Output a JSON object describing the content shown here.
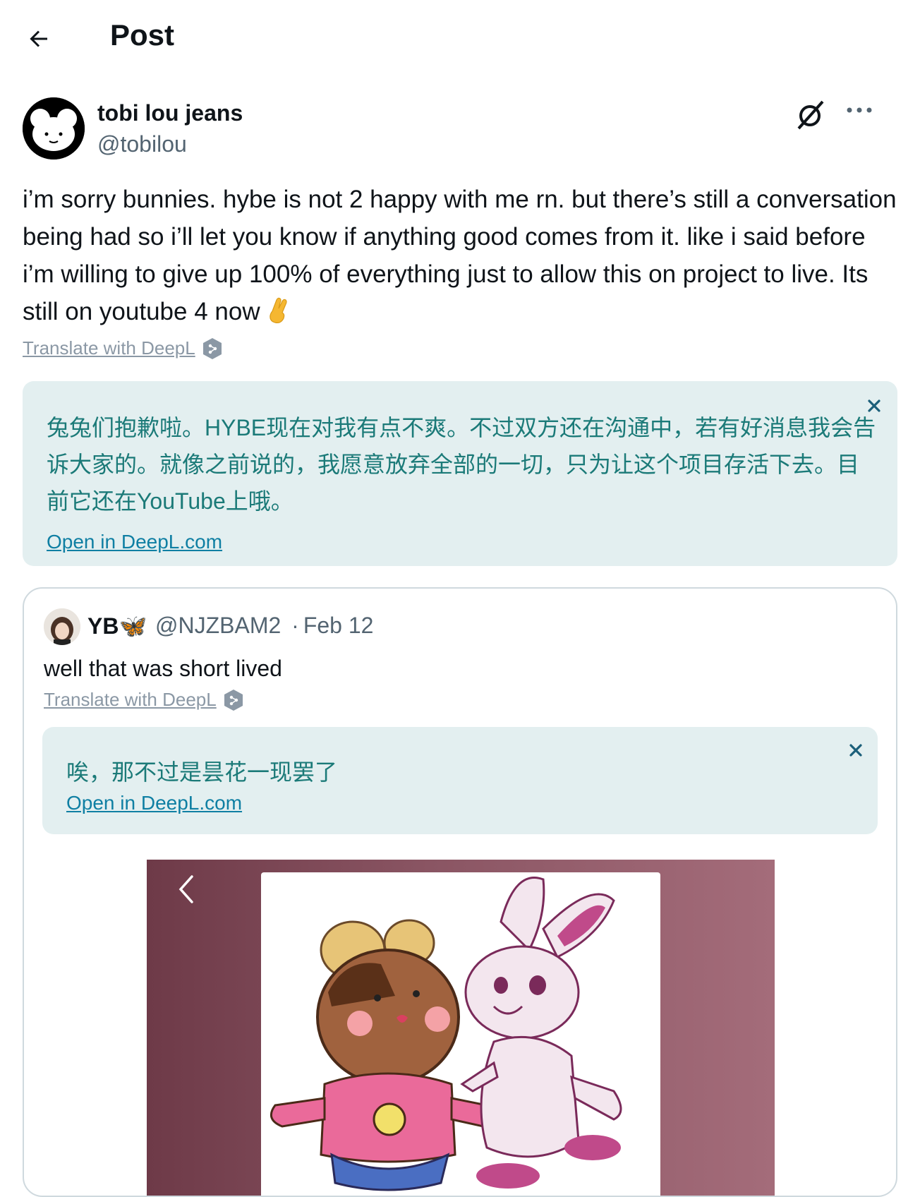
{
  "header": {
    "title": "Post"
  },
  "author": {
    "display_name": "tobi lou jeans",
    "handle": "@tobilou"
  },
  "post": {
    "text": "i’m sorry bunnies.  hybe is not 2 happy with me rn.  but there’s still a conversation being had so i’ll let you know if anything good comes from it.  like i said before i’m willing to give up 100% of everything just to allow this on project to live.   Its still on youtube 4 now",
    "emoji": "crossed-fingers-emoji",
    "translate_label": "Translate with DeepL"
  },
  "translation": {
    "text": "兔兔们抱歉啦。HYBE现在对我有点不爽。不过双方还在沟通中，若有好消息我会告诉大家的。就像之前说的，我愿意放弃全部的一切，只为让这个项目存活下去。目前它还在YouTube上哦。",
    "open_label": "Open in DeepL.com"
  },
  "quote": {
    "display_name": "YB🦋",
    "handle": "@NJZBAM2",
    "separator": "·",
    "date": "Feb 12",
    "text": "well that was short lived",
    "translate_label": "Translate with DeepL",
    "translation": {
      "text": "唉，那不过是昙花一现罢了",
      "open_label": "Open in DeepL.com"
    }
  },
  "icons": {
    "back": "arrow-left-icon",
    "grok": "grok-icon",
    "more": "more-icon",
    "close": "close-icon",
    "deepl": "deepl-icon",
    "prev": "chevron-left-icon"
  },
  "colors": {
    "text": "#0f1419",
    "secondary": "#536471",
    "translation_bg": "#e3eff0",
    "translation_text": "#1b7a78",
    "link": "#0f7fa3",
    "border": "#cfd9de"
  }
}
